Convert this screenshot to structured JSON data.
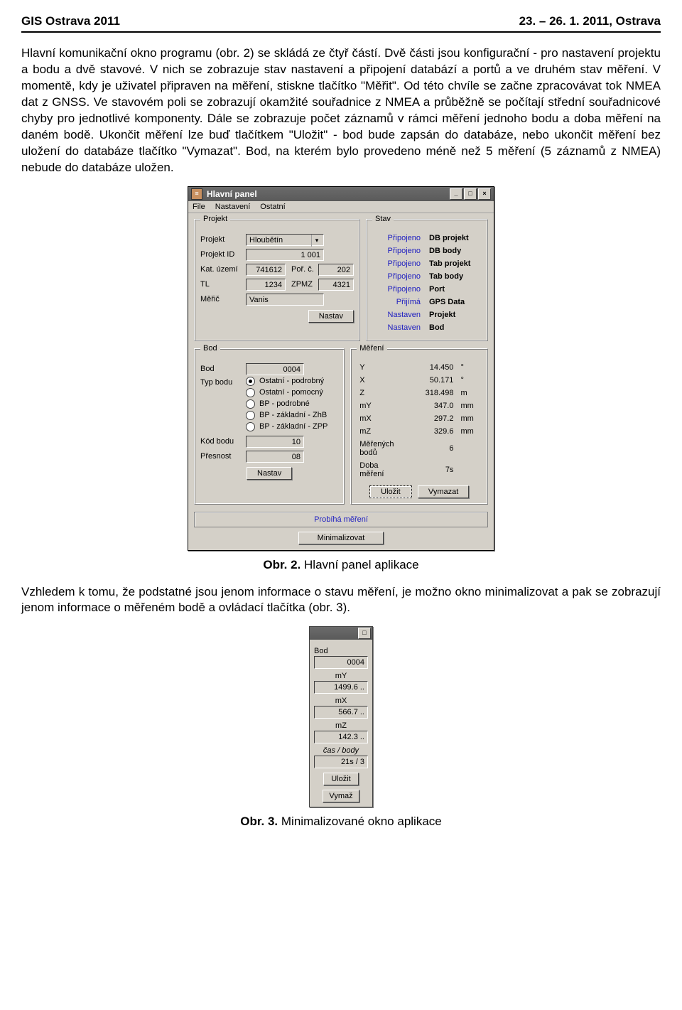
{
  "header": {
    "left": "GIS Ostrava 2011",
    "right": "23. – 26. 1. 2011, Ostrava"
  },
  "para1": "Hlavní komunikační okno programu (obr. 2) se skládá ze čtyř částí. Dvě části jsou konfigurační - pro nastavení projektu a bodu a dvě stavové. V nich se zobrazuje stav nastavení a připojení databází a portů a ve druhém stav měření. V momentě, kdy je uživatel připraven na měření, stiskne tlačítko \"Měřit\". Od této chvíle se začne zpracovávat tok NMEA dat z GNSS. Ve stavovém poli se zobrazují okamžité souřadnice z NMEA a průběžně se počítají střední souřadnicové chyby pro jednotlivé komponenty. Dále se zobrazuje počet záznamů v rámci měření jednoho bodu a doba měření na daném bodě. Ukončit měření lze buď tlačítkem \"Uložit\" - bod bude zapsán do databáze, nebo ukončit měření bez uložení do databáze tlačítko \"Vymazat\". Bod, na kterém bylo provedeno méně než 5 měření (5 záznamů z NMEA) nebude do databáze uložen.",
  "caption1_b": "Obr. 2.",
  "caption1_t": " Hlavní panel aplikace",
  "para2": "Vzhledem k tomu, že podstatné jsou jenom informace o stavu měření, je možno okno minimalizovat a pak se zobrazují jenom informace o měřeném bodě a ovládací tlačítka (obr. 3).",
  "caption2_b": "Obr. 3.",
  "caption2_t": " Minimalizované okno aplikace",
  "win": {
    "title": "Hlavní panel",
    "menu": {
      "file": "File",
      "nastaveni": "Nastavení",
      "ostatni": "Ostatní"
    },
    "projekt": {
      "legend": "Projekt",
      "l_projekt": "Projekt",
      "v_projekt": "Hloubětín",
      "l_projid": "Projekt ID",
      "v_projid": "1 001",
      "l_kat": "Kat. území",
      "v_kat": "741612",
      "l_porc": "Poř. č.",
      "v_porc": "202",
      "l_tl": "TL",
      "v_tl": "1234",
      "l_zpmz": "ZPMZ",
      "v_zpmz": "4321",
      "l_meric": "Měřič",
      "v_meric": "Vanis",
      "btn": "Nastav"
    },
    "stav": {
      "legend": "Stav",
      "rows": [
        {
          "k": "Připojeno",
          "v": "DB projekt"
        },
        {
          "k": "Připojeno",
          "v": "DB body"
        },
        {
          "k": "Připojeno",
          "v": "Tab projekt"
        },
        {
          "k": "Připojeno",
          "v": "Tab body"
        },
        {
          "k": "Připojeno",
          "v": "Port"
        },
        {
          "k": "Přijímá",
          "v": "GPS Data"
        },
        {
          "k": "Nastaven",
          "v": "Projekt"
        },
        {
          "k": "Nastaven",
          "v": "Bod"
        }
      ]
    },
    "bod": {
      "legend": "Bod",
      "l_bod": "Bod",
      "v_bod": "0004",
      "l_typ": "Typ bodu",
      "radios": [
        "Ostatní - podrobný",
        "Ostatní - pomocný",
        "BP - podrobné",
        "BP - základní - ZhB",
        "BP - základní - ZPP"
      ],
      "l_kod": "Kód bodu",
      "v_kod": "10",
      "l_pres": "Přesnost",
      "v_pres": "08",
      "btn": "Nastav"
    },
    "mereni": {
      "legend": "Měření",
      "rows": [
        {
          "k": "Y",
          "v": "14.450",
          "u": "°"
        },
        {
          "k": "X",
          "v": "50.171",
          "u": "°"
        },
        {
          "k": "Z",
          "v": "318.498",
          "u": "m"
        },
        {
          "k": "mY",
          "v": "347.0",
          "u": "mm"
        },
        {
          "k": "mX",
          "v": "297.2",
          "u": "mm"
        },
        {
          "k": "mZ",
          "v": "329.6",
          "u": "mm"
        },
        {
          "k": "Měřených bodů",
          "v": "6",
          "u": ""
        },
        {
          "k": "Doba měření",
          "v": "7s",
          "u": ""
        }
      ],
      "btn_ulozit": "Uložit",
      "btn_vymazat": "Vymazat"
    },
    "status": "Probíhá měření",
    "btn_min": "Minimalizovat"
  },
  "mini": {
    "l_bod": "Bod",
    "v_bod": "0004",
    "l_my": "mY",
    "v_my": "1499.6 ..",
    "l_mx": "mX",
    "v_mx": "566.7 ..",
    "l_mz": "mZ",
    "v_mz": "142.3 ..",
    "l_cas": "čas / body",
    "v_cas": "21s / 3",
    "btn_ulozit": "Uložit",
    "btn_vymaz": "Vymaž"
  }
}
